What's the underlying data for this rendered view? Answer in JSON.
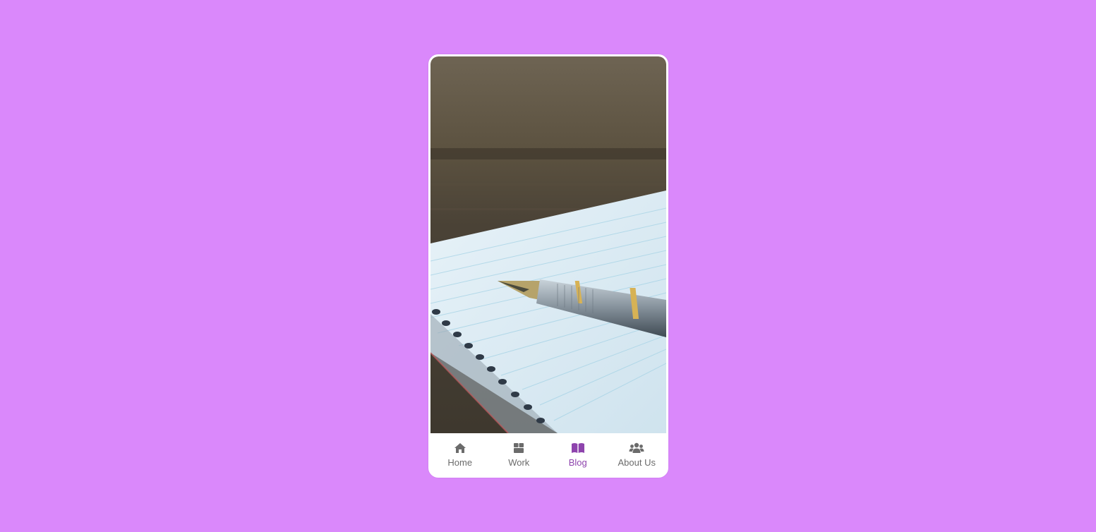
{
  "hero_image": {
    "description_icon": "notebook-fountain-pen-photo"
  },
  "bottom_nav": {
    "active_index": 2,
    "items": [
      {
        "label": "Home",
        "icon": "home-icon"
      },
      {
        "label": "Work",
        "icon": "box-icon"
      },
      {
        "label": "Blog",
        "icon": "book-open-icon"
      },
      {
        "label": "About Us",
        "icon": "users-icon"
      }
    ]
  },
  "colors": {
    "background": "#da88fb",
    "nav_active": "#8e44ad",
    "nav_inactive": "#6b6b6b"
  }
}
